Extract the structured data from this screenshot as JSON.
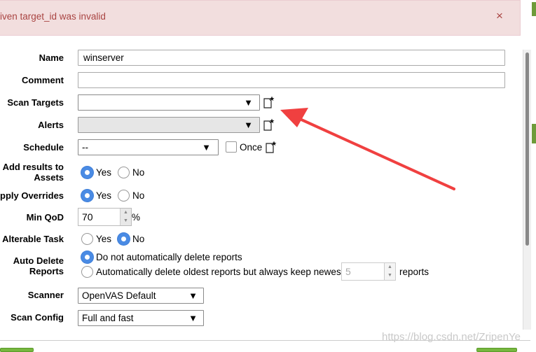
{
  "alert": {
    "message": "iven target_id was invalid",
    "close": "×"
  },
  "form": {
    "name": {
      "label": "Name",
      "value": "winserver"
    },
    "comment": {
      "label": "Comment",
      "value": ""
    },
    "scan_targets": {
      "label": "Scan Targets",
      "value": ""
    },
    "alerts": {
      "label": "Alerts",
      "value": ""
    },
    "schedule": {
      "label": "Schedule",
      "value": "--",
      "once_label": "Once",
      "once_checked": false
    },
    "add_results": {
      "label": "Add results to Assets",
      "yes": "Yes",
      "no": "No",
      "selected": "Yes"
    },
    "apply_overrides": {
      "label": "pply Overrides",
      "yes": "Yes",
      "no": "No",
      "selected": "Yes"
    },
    "min_qod": {
      "label": "Min QoD",
      "value": "70",
      "unit": "%"
    },
    "alterable_task": {
      "label": "Alterable Task",
      "yes": "Yes",
      "no": "No",
      "selected": "No"
    },
    "auto_delete": {
      "label": "Auto Delete Reports",
      "option_none": "Do not automatically delete reports",
      "option_keep": "Automatically delete oldest reports but always keep newest",
      "keep_value": "5",
      "keep_suffix": "reports",
      "selected": "none"
    },
    "scanner": {
      "label": "Scanner",
      "value": "OpenVAS Default"
    },
    "scan_config": {
      "label": "Scan Config",
      "value": "Full and fast"
    }
  },
  "caret": "▼",
  "spin_up": "▲",
  "spin_down": "▼",
  "watermark": "https://blog.csdn.net/ZripenYe",
  "colors": {
    "alert_bg": "#f2dede",
    "alert_text": "#a94442",
    "radio_on": "#4a8be4",
    "arrow": "#f04040",
    "button_green": "#77b73f"
  },
  "icons": {
    "new_target": "new-icon",
    "new_alert": "new-icon",
    "new_schedule": "new-icon"
  }
}
